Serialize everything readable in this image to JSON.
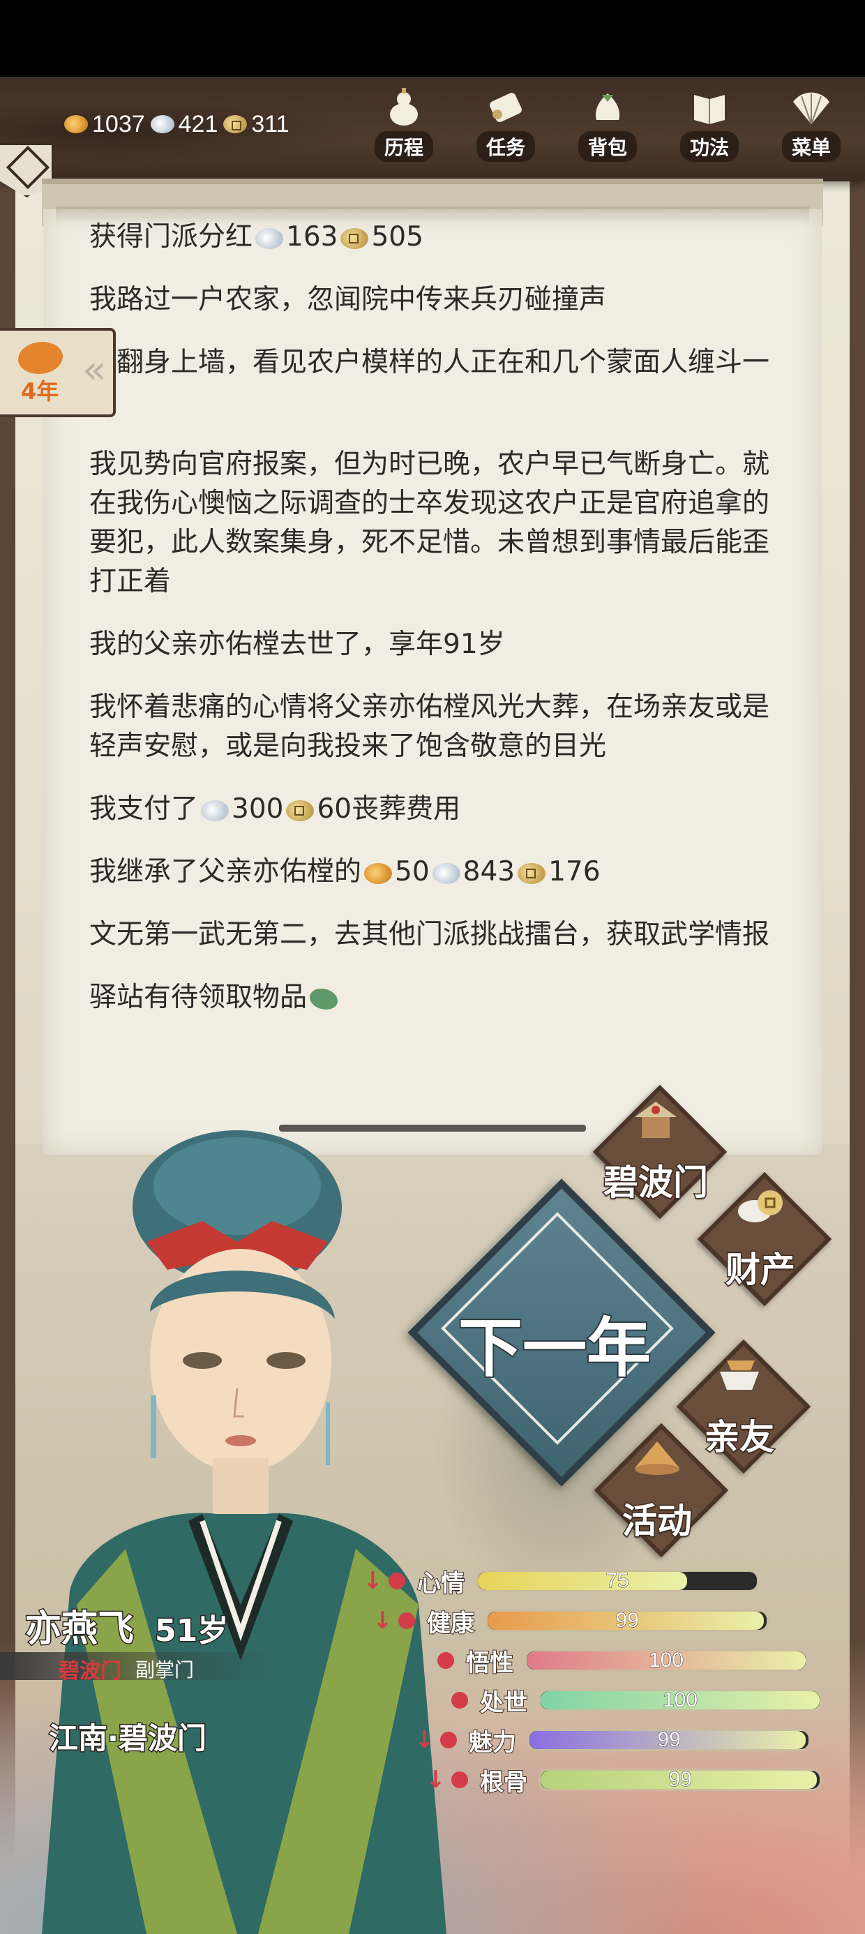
{
  "resources": {
    "gold": "1037",
    "silver": "421",
    "copper": "311"
  },
  "nav": [
    {
      "label": "历程",
      "icon": "gourd-icon"
    },
    {
      "label": "任务",
      "icon": "scroll-icon"
    },
    {
      "label": "背包",
      "icon": "bag-icon"
    },
    {
      "label": "功法",
      "icon": "book-icon"
    },
    {
      "label": "菜单",
      "icon": "fan-icon"
    }
  ],
  "year_tag": {
    "label": "4年"
  },
  "events": [
    {
      "text": "获得门派分红",
      "tail": "163",
      "tail2": "505"
    },
    {
      "text": "我路过一户农家，忽闻院中传来兵刃碰撞声"
    },
    {
      "text": "我翻身上墙，看见农户模样的人正在和几个蒙面人缠斗一起"
    },
    {
      "text": "我见势向官府报案，但为时已晚，农户早已气断身亡。就在我伤心懊恼之际调查的士卒发现这农户正是官府追拿的要犯，此人数案集身，死不足惜。未曾想到事情最后能歪打正着"
    },
    {
      "text": "我的父亲亦佑樘去世了，享年91岁"
    },
    {
      "text": "我怀着悲痛的心情将父亲亦佑樘风光大葬，在场亲友或是轻声安慰，或是向我投来了饱含敬意的目光"
    },
    {
      "text_prefix": "我支付了",
      "silver": "300",
      "copper": "60",
      "text_suffix": "丧葬费用"
    },
    {
      "text_prefix": "我继承了父亲亦佑樘的",
      "gold": "50",
      "silver": "843",
      "copper": "176"
    },
    {
      "text": "文无第一武无第二，去其他门派挑战擂台，获取武学情报"
    },
    {
      "text": "驿站有待领取物品"
    }
  ],
  "actions": {
    "sect": "碧波门",
    "assets": "财产",
    "next_year": "下一年",
    "relatives": "亲友",
    "activity": "活动"
  },
  "character": {
    "name": "亦燕飞",
    "age": "51岁",
    "sect": "碧波门",
    "rank": "副掌门",
    "location": "江南·碧波门"
  },
  "stats": [
    {
      "label": "心情",
      "value": "75",
      "pct": 0.75,
      "down": true,
      "color": "#e8d35a",
      "icon": "mood-icon"
    },
    {
      "label": "健康",
      "value": "99",
      "pct": 0.99,
      "down": true,
      "color": "#e89a4a",
      "icon": "heart-icon"
    },
    {
      "label": "悟性",
      "value": "100",
      "pct": 1.0,
      "down": false,
      "color": "#e07a8a",
      "icon": "insight-icon"
    },
    {
      "label": "处世",
      "value": "100",
      "pct": 1.0,
      "down": false,
      "color": "#7fd3a6",
      "icon": "flower-icon"
    },
    {
      "label": "魅力",
      "value": "99",
      "pct": 0.99,
      "down": true,
      "color": "#8a6ee0",
      "icon": "charm-icon"
    },
    {
      "label": "根骨",
      "value": "99",
      "pct": 0.99,
      "down": true,
      "color": "#b6d27a",
      "icon": "lotus-icon"
    }
  ],
  "colors": {
    "header": "#3f2e24",
    "paper": "#f1ede3",
    "accent_red": "#d63b3b",
    "next_year_blue": "#4e7480"
  }
}
